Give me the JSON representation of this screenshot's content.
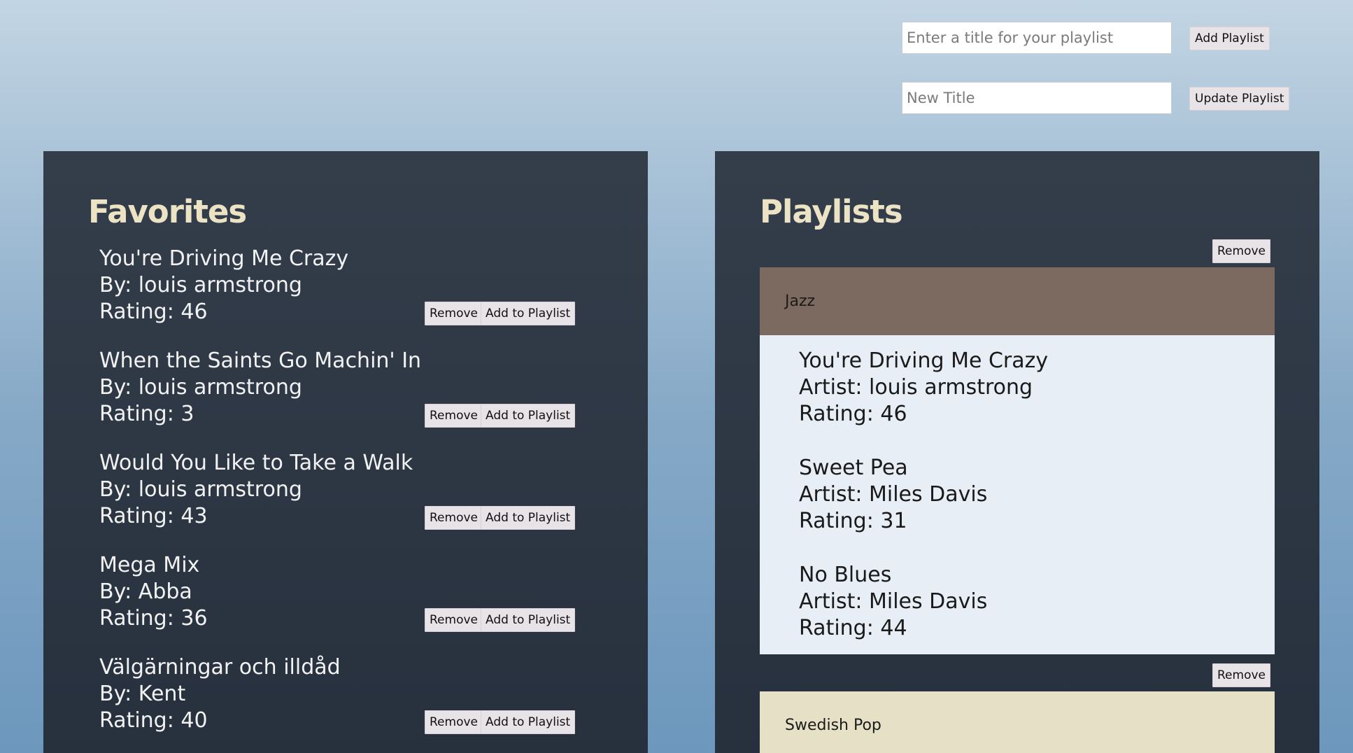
{
  "top_forms": {
    "new_playlist": {
      "placeholder": "Enter a title for your playlist",
      "button": "Add Playlist"
    },
    "update_playlist": {
      "placeholder": "New Title",
      "button": "Update Playlist"
    }
  },
  "favorites": {
    "title": "Favorites",
    "remove_label": "Remove",
    "add_label": "Add to Playlist",
    "songs": [
      {
        "title": "You're Driving Me Crazy",
        "by": "By: louis armstrong",
        "rating": "Rating: 46"
      },
      {
        "title": "When the Saints Go Machin' In",
        "by": "By: louis armstrong",
        "rating": "Rating: 3"
      },
      {
        "title": "Would You Like to Take a Walk",
        "by": "By: louis armstrong",
        "rating": "Rating: 43"
      },
      {
        "title": "Mega Mix",
        "by": "By: Abba",
        "rating": "Rating: 36"
      },
      {
        "title": "Välgärningar och illdåd",
        "by": "By: Kent",
        "rating": "Rating: 40"
      }
    ]
  },
  "playlists": {
    "title": "Playlists",
    "remove_label": "Remove",
    "items": [
      {
        "name": "Jazz",
        "color": "#7c6a60",
        "songs": [
          {
            "title": "You're Driving Me Crazy",
            "artist": "Artist: louis armstrong",
            "rating": "Rating: 46"
          },
          {
            "title": "Sweet Pea",
            "artist": "Artist: Miles Davis",
            "rating": "Rating: 31"
          },
          {
            "title": "No Blues",
            "artist": "Artist: Miles Davis",
            "rating": "Rating: 44"
          }
        ]
      },
      {
        "name": "Swedish Pop",
        "color": "#e6e0c7",
        "songs": []
      }
    ]
  }
}
